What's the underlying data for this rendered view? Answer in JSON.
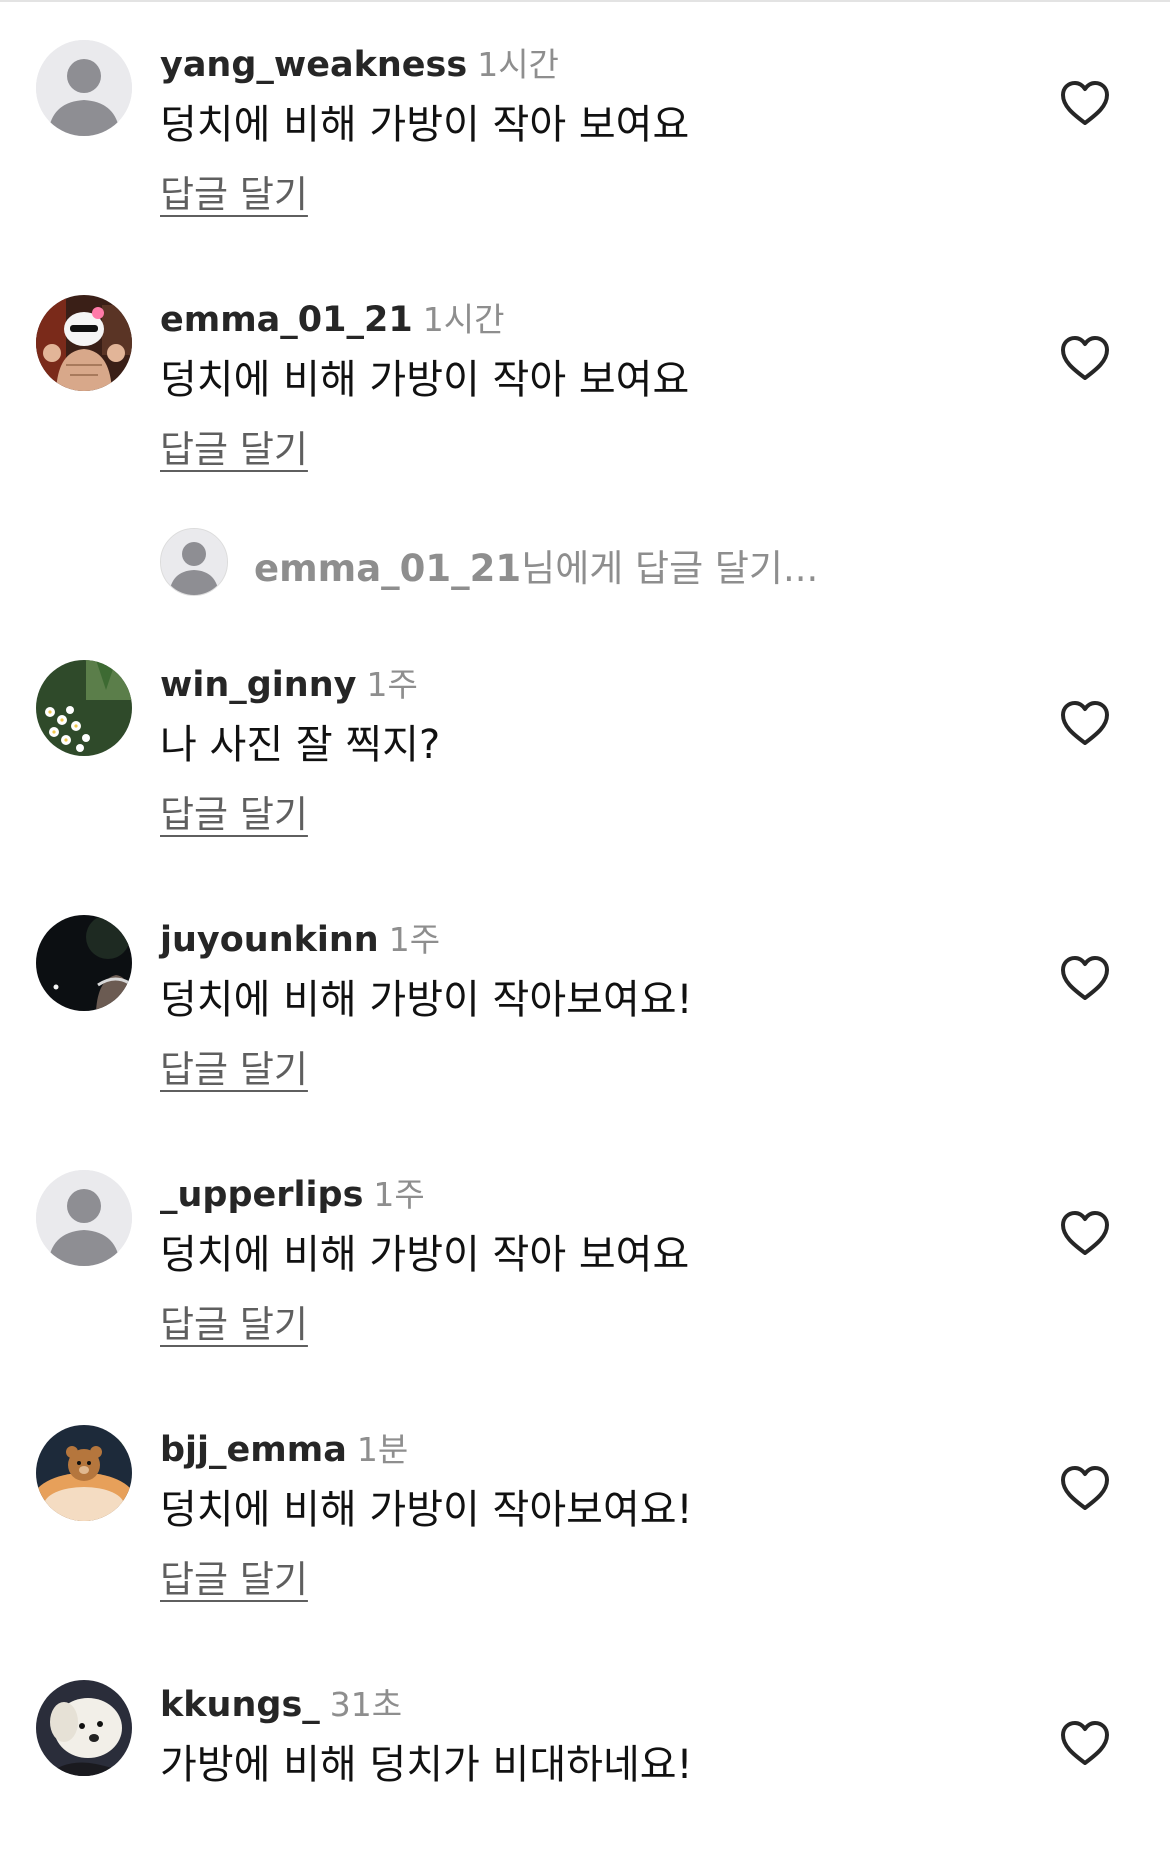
{
  "comments": [
    {
      "username": "yang_weakness",
      "time": "1시간",
      "text": "덩치에 비해 가방이 작아 보여요",
      "reply_label": "답글 달기",
      "avatar": "default-avatar-icon"
    },
    {
      "username": "emma_01_21",
      "time": "1시간",
      "text": "덩치에 비해 가방이 작아 보여요",
      "reply_label": "답글 달기",
      "avatar": "muscle-cat-photo"
    },
    {
      "username": "win_ginny",
      "time": "1주",
      "text": "나 사진 잘 찍지?",
      "reply_label": "답글 달기",
      "avatar": "flowers-photo"
    },
    {
      "username": "juyounkinn",
      "time": "1주",
      "text": "덩치에 비해 가방이 작아보여요!",
      "reply_label": "답글 달기",
      "avatar": "night-photo"
    },
    {
      "username": "_upperlips",
      "time": "1주",
      "text": "덩치에 비해 가방이 작아 보여요",
      "reply_label": "답글 달기",
      "avatar": "default-avatar-icon"
    },
    {
      "username": "bjj_emma",
      "time": "1분",
      "text": "덩치에 비해 가방이 작아보여요!",
      "reply_label": "답글 달기",
      "avatar": "teddy-bear-photo"
    },
    {
      "username": "kkungs_",
      "time": "31초",
      "text": "가방에 비해 덩치가 비대하네요!",
      "reply_label": "답글 달기",
      "avatar": "dog-photo"
    }
  ],
  "reply_input": {
    "target_username": "emma_01_21",
    "placeholder_suffix": "님에게 답글 달기..."
  },
  "colors": {
    "username": "#262626",
    "meta": "#8e8e8e",
    "text": "#111111",
    "reply": "#5f5f5f",
    "heart": "#262626"
  }
}
